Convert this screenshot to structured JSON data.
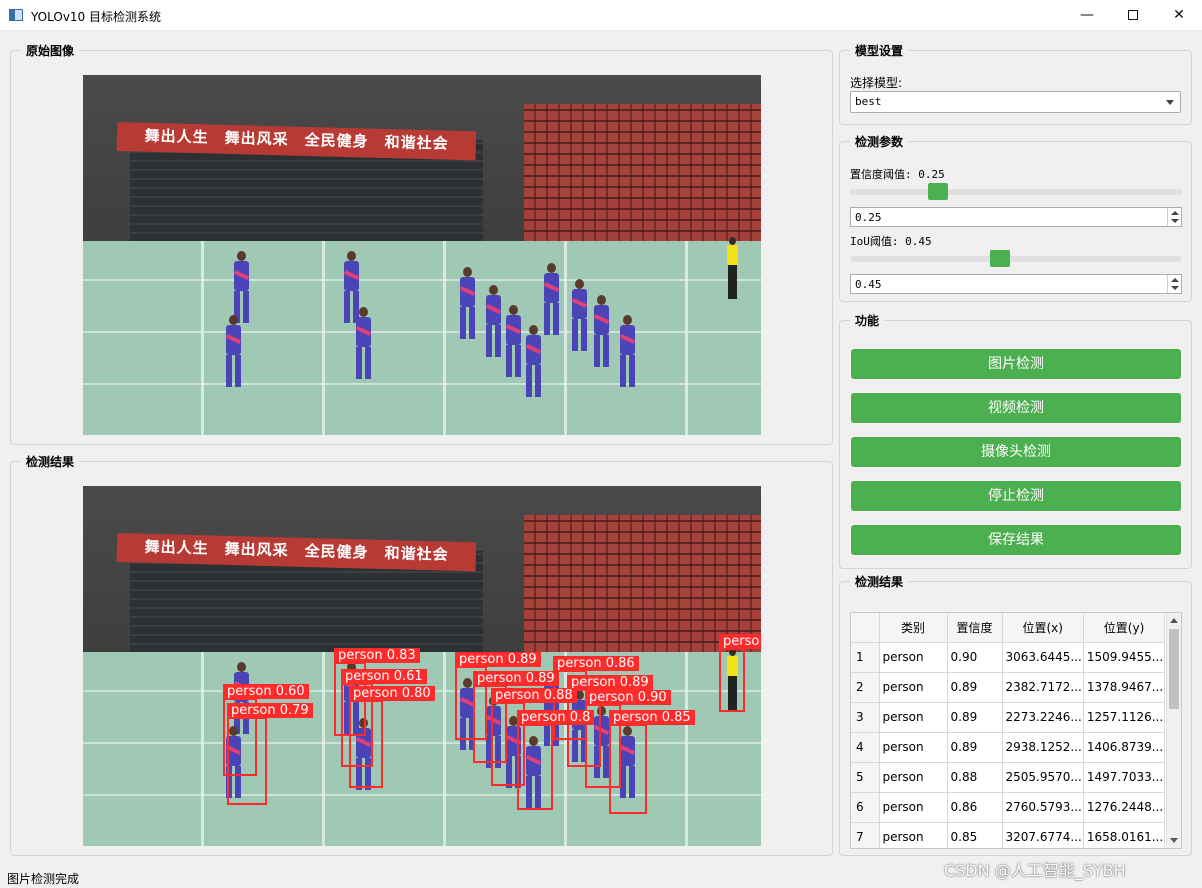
{
  "window": {
    "title": "YOLOv10 目标检测系统",
    "minimize": "—",
    "close": "✕"
  },
  "original_panel": {
    "title": "原始图像"
  },
  "result_panel": {
    "title": "检测结果"
  },
  "scene": {
    "banner": "舞出人生　舞出风采　全民健身　和谐社会"
  },
  "detections": [
    {
      "label": "person 0.83"
    },
    {
      "label": "person 0.89"
    },
    {
      "label": "person 0.86"
    },
    {
      "label": "person 0.61"
    },
    {
      "label": "person 0.89"
    },
    {
      "label": "person 0.89"
    },
    {
      "label": "person 0.60"
    },
    {
      "label": "person 0.80"
    },
    {
      "label": "person 0.88"
    },
    {
      "label": "person 0.90"
    },
    {
      "label": "person 0.79"
    },
    {
      "label": "person 0.8"
    },
    {
      "label": "person 0.85"
    },
    {
      "label": "perso"
    }
  ],
  "model_settings": {
    "title": "模型设置",
    "select_label": "选择模型:",
    "selected_model": "best"
  },
  "params": {
    "title": "检测参数",
    "conf_label": "置信度阈值: 0.25",
    "conf_value": "0.25",
    "conf_fraction": 0.25,
    "iou_label": "IoU阈值: 0.45",
    "iou_value": "0.45",
    "iou_fraction": 0.45
  },
  "functions": {
    "title": "功能",
    "buttons": [
      "图片检测",
      "视频检测",
      "摄像头检测",
      "停止检测",
      "保存结果"
    ],
    "button_color": "#4caf50"
  },
  "results_table": {
    "title": "检测结果",
    "headers": [
      "类别",
      "置信度",
      "位置(x)",
      "位置(y)"
    ],
    "rows": [
      {
        "num": "1",
        "cls": "person",
        "conf": "0.90",
        "x": "3063.6445...",
        "y": "1509.9455..."
      },
      {
        "num": "2",
        "cls": "person",
        "conf": "0.89",
        "x": "2382.7172...",
        "y": "1378.9467..."
      },
      {
        "num": "3",
        "cls": "person",
        "conf": "0.89",
        "x": "2273.2246...",
        "y": "1257.1126..."
      },
      {
        "num": "4",
        "cls": "person",
        "conf": "0.89",
        "x": "2938.1252...",
        "y": "1406.8739..."
      },
      {
        "num": "5",
        "cls": "person",
        "conf": "0.88",
        "x": "2505.9570...",
        "y": "1497.7033..."
      },
      {
        "num": "6",
        "cls": "person",
        "conf": "0.86",
        "x": "2760.5793...",
        "y": "1276.2448..."
      },
      {
        "num": "7",
        "cls": "person",
        "conf": "0.85",
        "x": "3207.6774...",
        "y": "1658.0161..."
      }
    ]
  },
  "status": {
    "text": "图片检测完成"
  },
  "watermark": "CSDN @人工智能_SYBH"
}
